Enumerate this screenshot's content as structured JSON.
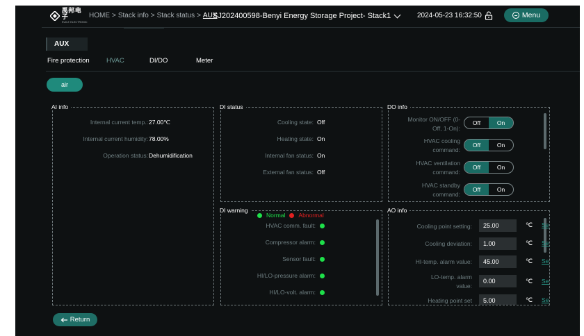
{
  "header": {
    "breadcrumb": [
      "HOME",
      ">",
      "Stack info",
      ">",
      "Stack status",
      ">",
      "AUX"
    ],
    "project": "SJ202400598-Benyi Energy Storage Project- Stack1",
    "datetime": "2024-05-23 16:32:50",
    "menu_label": "Menu",
    "logo_text": "禹邦电子",
    "logo_subtext": "HUILE ELECTRONIC"
  },
  "section_title": "AUX",
  "tabs": [
    "Fire protection",
    "HVAC",
    "DI/DO",
    "Meter"
  ],
  "active_tab": "HVAC",
  "air_button": "air",
  "ai_info": {
    "title": "AI info",
    "rows": [
      {
        "label": "Internal current temp.:",
        "value": "27.00℃"
      },
      {
        "label": "Internal current humidity:",
        "value": "78.00%"
      },
      {
        "label": "Operation status:",
        "value": "Dehumidification"
      }
    ]
  },
  "di_status": {
    "title": "DI status",
    "rows": [
      {
        "label": "Cooling state:",
        "value": "Off"
      },
      {
        "label": "Heating state:",
        "value": "On"
      },
      {
        "label": "Internal fan status:",
        "value": "On"
      },
      {
        "label": "External fan status:",
        "value": "Off"
      }
    ]
  },
  "do_info": {
    "title": "DO info",
    "off_label": "Off",
    "on_label": "On",
    "rows": [
      {
        "label1": "Monitor ON/OFF (0-",
        "label2": "Off, 1-On):",
        "state": "On"
      },
      {
        "label1": "HVAC cooling",
        "label2": "command:",
        "state": "Off"
      },
      {
        "label1": "HVAC ventilation",
        "label2": "command:",
        "state": "Off"
      },
      {
        "label1": "HVAC standby",
        "label2": "command:",
        "state": "Off"
      }
    ]
  },
  "di_warning": {
    "title": "DI warning",
    "normal_label": "Normal",
    "abnormal_label": "Abnormal",
    "normal_color": "#1ee04a",
    "abnormal_color": "#e02020",
    "rows": [
      {
        "label": "HVAC comm. fault:",
        "status": "normal"
      },
      {
        "label": "Compressor alarm:",
        "status": "normal"
      },
      {
        "label": "Sensor fault:",
        "status": "normal"
      },
      {
        "label": "HI/LO-pressure alarm:",
        "status": "normal"
      },
      {
        "label": "HI/LO-volt. alarm:",
        "status": "normal"
      }
    ]
  },
  "ao_info": {
    "title": "AO info",
    "unit": "℃",
    "set_label": "Set",
    "rows": [
      {
        "label1": "Cooling point setting:",
        "label2": "",
        "value": "25.00"
      },
      {
        "label1": "Cooling deviation:",
        "label2": "",
        "value": "1.00"
      },
      {
        "label1": "HI-temp. alarm value:",
        "label2": "",
        "value": "45.00"
      },
      {
        "label1": "LO-temp. alarm",
        "label2": "value:",
        "value": "0.00"
      },
      {
        "label1": "Heating point set",
        "label2": "",
        "value": "5.00"
      }
    ]
  },
  "return_label": "Return",
  "colors": {
    "background": "#0e1112",
    "accent": "#1a6b63",
    "button": "#1f8a7c",
    "active_tab": "#6f9d9a",
    "label": "#6f7f82"
  }
}
